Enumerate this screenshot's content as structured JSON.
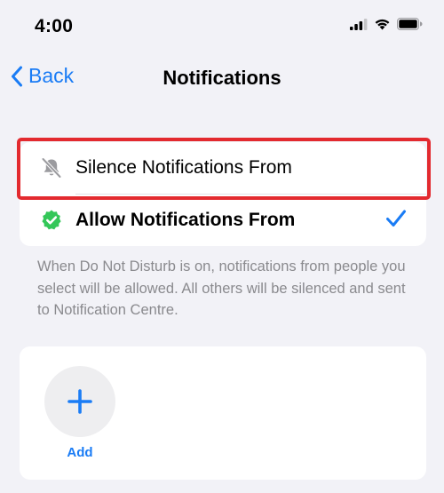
{
  "status_bar": {
    "time": "4:00"
  },
  "nav": {
    "back_label": "Back",
    "title": "Notifications"
  },
  "options": [
    {
      "label": "Silence Notifications From",
      "icon": "bell-slash-icon",
      "selected": false,
      "highlighted": true
    },
    {
      "label": "Allow Notifications From",
      "icon": "verified-badge-icon",
      "selected": true,
      "highlighted": false
    }
  ],
  "footer": "When Do Not Disturb is on, notifications from people you select will be allowed. All others will be silenced and sent to Notification Centre.",
  "people": {
    "add_label": "Add"
  },
  "colors": {
    "accent": "#1a7cf5",
    "highlight": "#e32a2f",
    "badge_green": "#34c759",
    "background": "#f2f2f7"
  }
}
